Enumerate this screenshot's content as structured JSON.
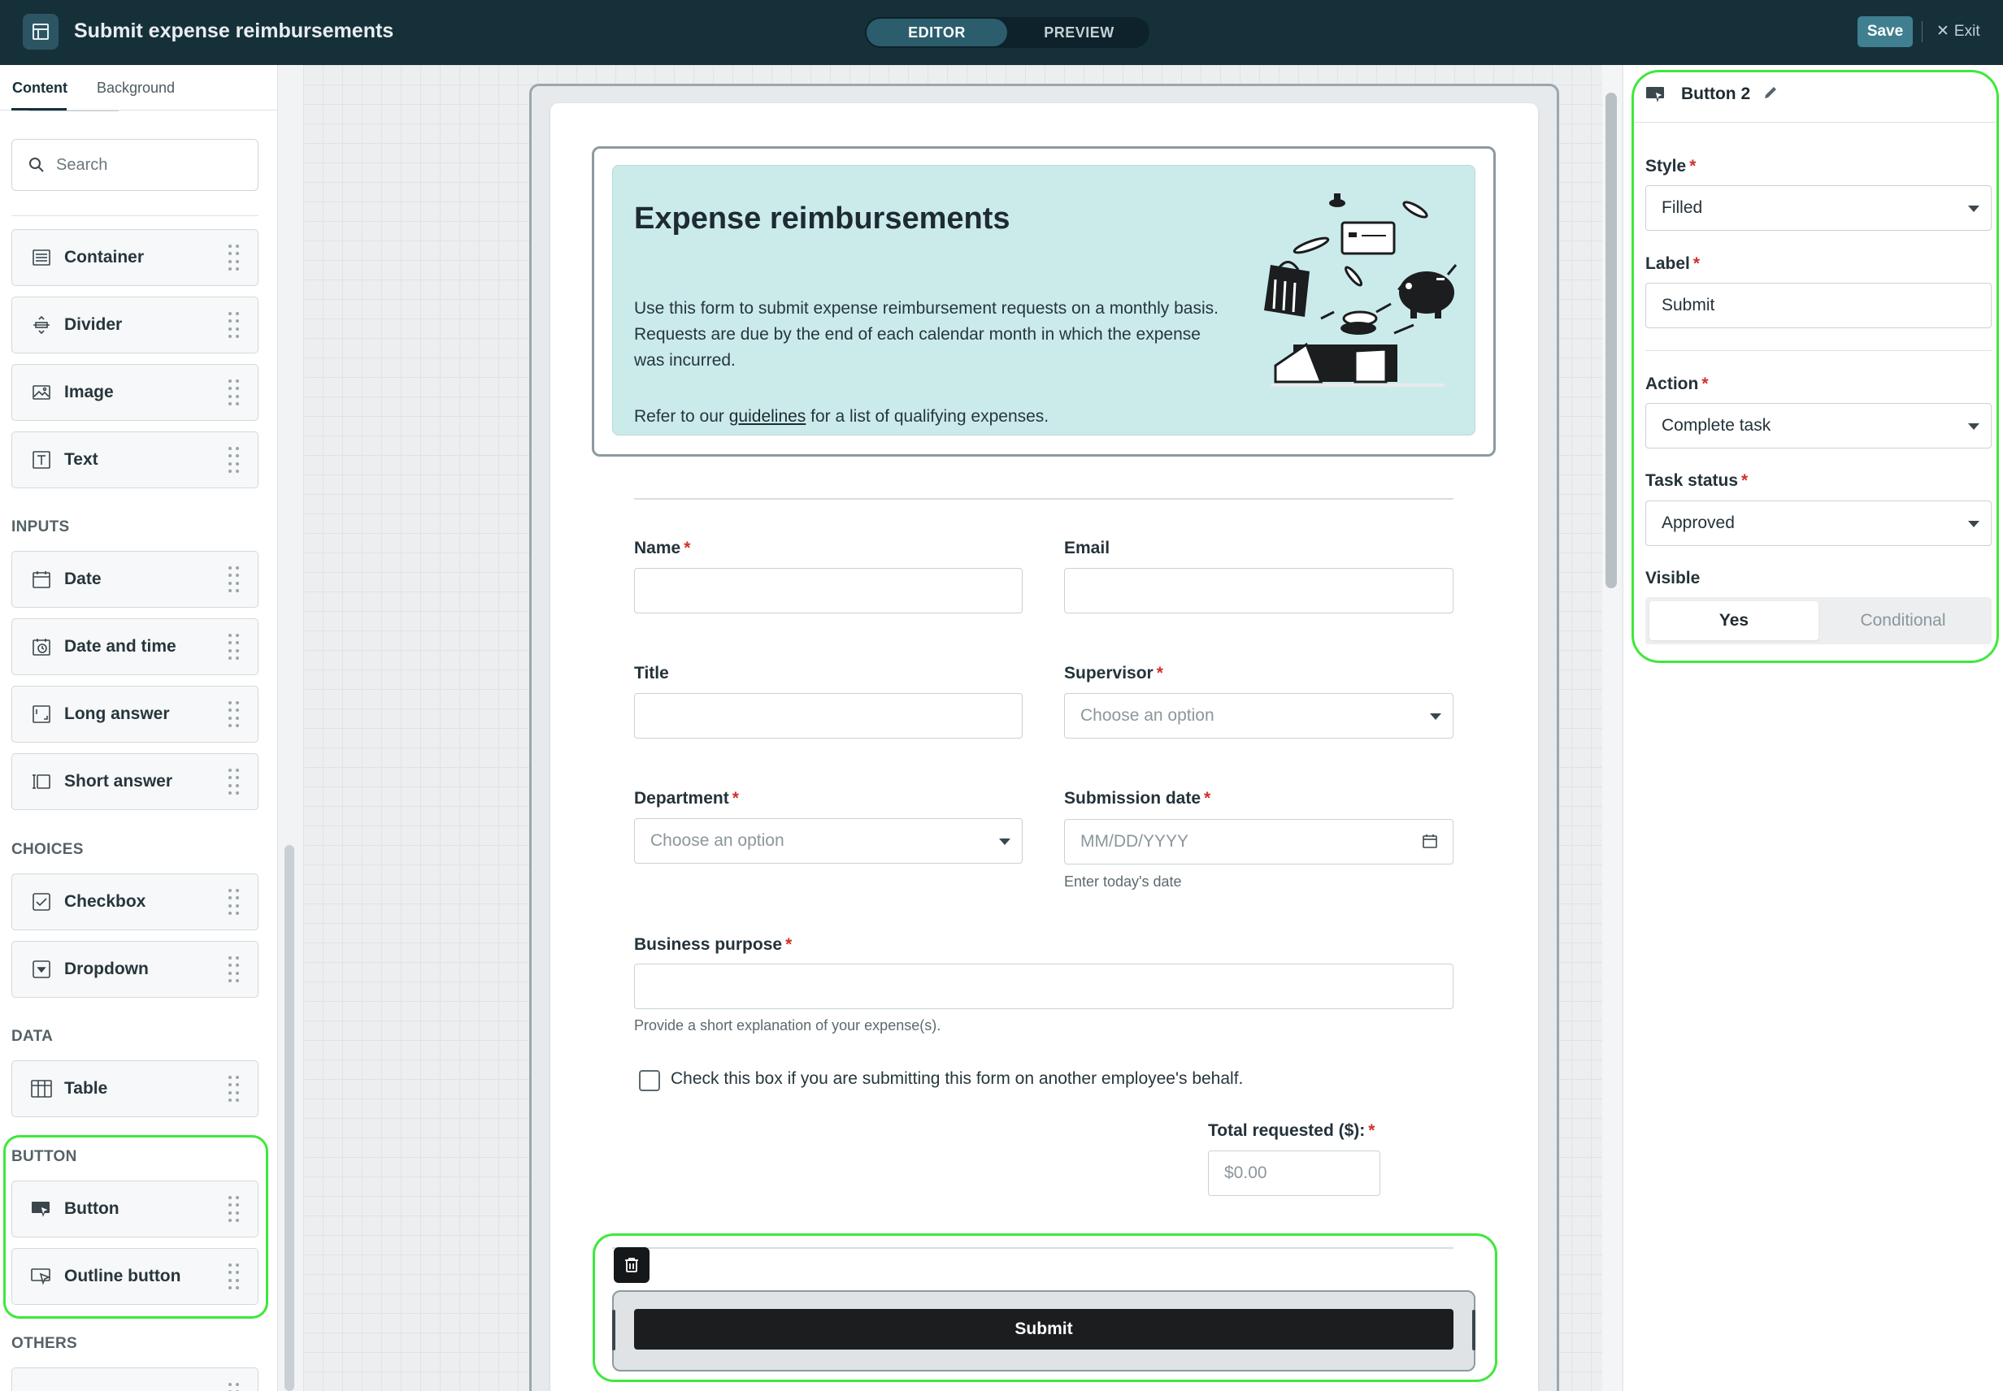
{
  "header": {
    "title": "Submit expense reimbursements",
    "tabs": [
      "EDITOR",
      "PREVIEW"
    ],
    "active_tab": "EDITOR",
    "save_label": "Save",
    "exit_label": "Exit"
  },
  "left_panel": {
    "tabs": [
      "Content",
      "Background"
    ],
    "active_tab": "Content",
    "search_placeholder": "Search",
    "layout_items": [
      "Container",
      "Divider",
      "Image",
      "Text"
    ],
    "sections": {
      "inputs": {
        "title": "INPUTS",
        "items": [
          "Date",
          "Date and time",
          "Long answer",
          "Short answer"
        ]
      },
      "choices": {
        "title": "CHOICES",
        "items": [
          "Checkbox",
          "Dropdown"
        ]
      },
      "data": {
        "title": "DATA",
        "items": [
          "Table"
        ]
      },
      "button": {
        "title": "BUTTON",
        "items": [
          "Button",
          "Outline button"
        ]
      },
      "others": {
        "title": "OTHERS"
      }
    }
  },
  "form": {
    "banner": {
      "title": "Expense reimbursements",
      "body": "Use this form to submit expense reimbursement requests on a monthly basis. Requests are due by the end of each calendar month in which the expense was incurred.",
      "ref_prefix": "Refer to our ",
      "ref_link": "guidelines",
      "ref_suffix": " for a list of qualifying expenses."
    },
    "fields": {
      "name": {
        "label": "Name",
        "required": true
      },
      "email": {
        "label": "Email",
        "required": false
      },
      "title": {
        "label": "Title",
        "required": false
      },
      "supervisor": {
        "label": "Supervisor",
        "required": true,
        "placeholder": "Choose an option"
      },
      "department": {
        "label": "Department",
        "required": true,
        "placeholder": "Choose an option"
      },
      "submission_date": {
        "label": "Submission date",
        "required": true,
        "placeholder": "MM/DD/YYYY",
        "help": "Enter today's date"
      },
      "business_purpose": {
        "label": "Business purpose",
        "required": true,
        "help": "Provide a short explanation of your expense(s)."
      },
      "on_behalf": {
        "label": "Check this box if you are submitting this form on another employee's behalf.",
        "checked": false
      },
      "total": {
        "label": "Total requested ($):",
        "required": true,
        "placeholder": "$0.00"
      }
    },
    "submit_label": "Submit"
  },
  "properties": {
    "title": "Button 2",
    "style": {
      "label": "Style",
      "value": "Filled"
    },
    "label": {
      "label": "Label",
      "value": "Submit"
    },
    "action": {
      "label": "Action",
      "value": "Complete task"
    },
    "task_status": {
      "label": "Task status",
      "value": "Approved"
    },
    "visible": {
      "label": "Visible",
      "options": [
        "Yes",
        "Conditional"
      ],
      "selected": "Yes"
    }
  },
  "colors": {
    "topbar": "#16303a",
    "banner": "#cbebeb",
    "highlight": "#3fe83a",
    "save": "#3f7f90",
    "required": "#d0312d"
  }
}
